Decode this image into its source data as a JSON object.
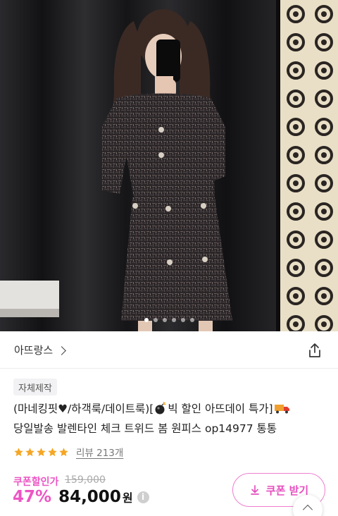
{
  "hero": {
    "image_description": "",
    "carousel": {
      "count": 6,
      "active_index": 0
    }
  },
  "brand": {
    "name": "아뜨랑스"
  },
  "badge": {
    "label": "자체제작"
  },
  "product": {
    "title_line1_a": "(마네킹핏♥/하객룩/데이트룩)[",
    "title_line1_b": "빅 할인 아뜨데이 특가]",
    "title_line2": "당일발송 발렌타인 체크 트위드 봄 원피스 op14977 통통"
  },
  "rating": {
    "stars": 5,
    "review_label": "리뷰 213개"
  },
  "price": {
    "coupon_label": "쿠폰할인가",
    "original": "159,000",
    "discount": "47%",
    "current": "84,000",
    "unit": "원",
    "info": "i"
  },
  "buttons": {
    "coupon": "쿠폰 받기"
  },
  "colors": {
    "accent": "#ec55c4",
    "star": "#f5a623"
  }
}
